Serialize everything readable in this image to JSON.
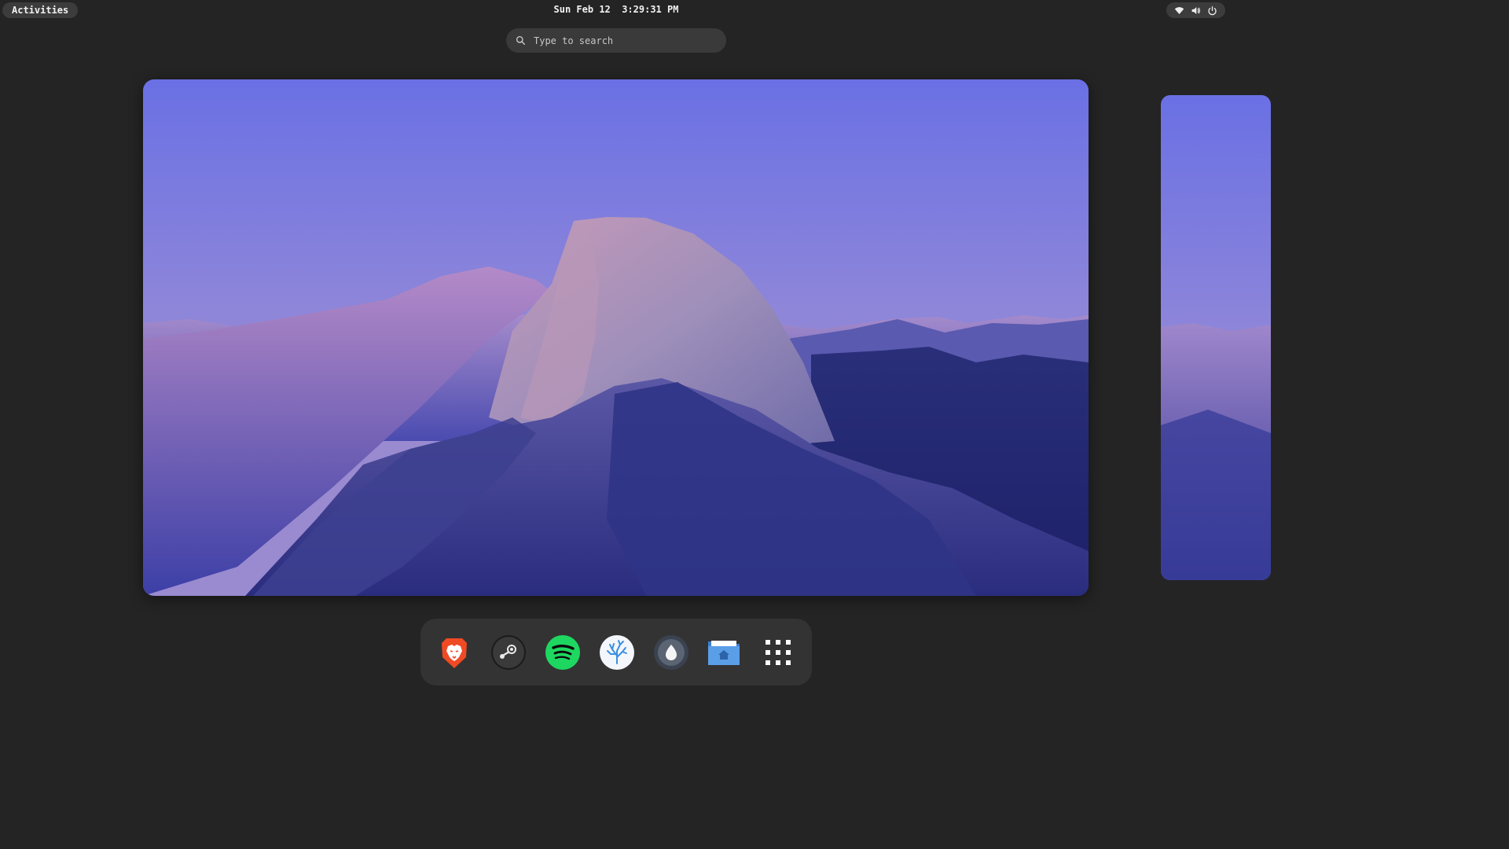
{
  "topbar": {
    "activities_label": "Activities",
    "clock": "Sun Feb 12  3:29:31 PM",
    "tray_icons": [
      "wifi-icon",
      "volume-icon",
      "power-icon"
    ]
  },
  "search": {
    "placeholder": "Type to search"
  },
  "overview": {
    "wallpaper": "Half Dome at dusk, purple sky",
    "accent_sky_top": "#6c72e2",
    "accent_sky_bottom": "#8f86d8"
  },
  "dock": {
    "items": [
      {
        "name": "brave-browser",
        "icon": "brave-lion-icon",
        "color": "#f04a24"
      },
      {
        "name": "steam",
        "icon": "steam-icon",
        "color": "#2a2a2a"
      },
      {
        "name": "spotify",
        "icon": "spotify-icon",
        "color": "#1ed760"
      },
      {
        "name": "coral-app",
        "icon": "coral-icon",
        "color": "#3b8fe0"
      },
      {
        "name": "drop-app",
        "icon": "drop-icon",
        "color": "#4c5563"
      },
      {
        "name": "files",
        "icon": "home-folder-icon",
        "color": "#5b9ee8"
      },
      {
        "name": "show-applications",
        "icon": "app-grid-icon",
        "color": "#ffffff"
      }
    ]
  }
}
